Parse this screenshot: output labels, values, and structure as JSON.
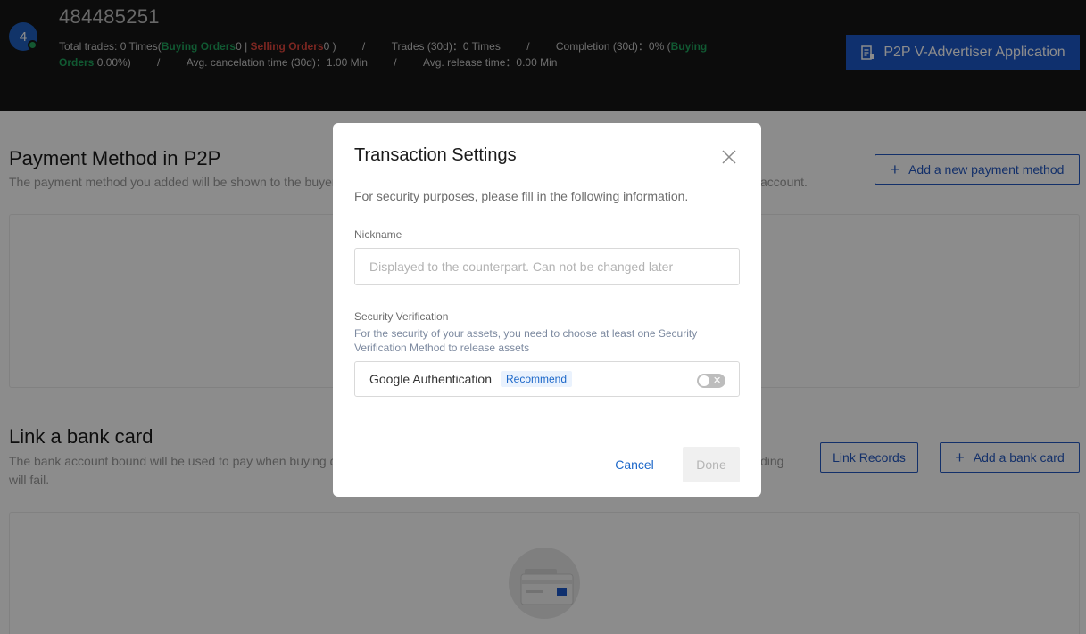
{
  "header": {
    "avatar_letter": "4",
    "user_id": "484485251",
    "stats": {
      "total_trades_prefix": "Total trades: 0 Times(",
      "buying_orders_label": "Buying Orders",
      "buying_orders_value": "0 | ",
      "selling_orders_label": "Selling Orders",
      "selling_orders_value": "0 )",
      "sep": "/",
      "trades_30d": "Trades (30d)：0 Times",
      "completion_30d": "Completion (30d)：0% (",
      "completion_buying_label": "Buying Orders",
      "completion_buying_value": " 0.00%)",
      "avg_cancel": "Avg. cancelation time (30d)：1.00 Min",
      "avg_release": "Avg. release time：0.00 Min"
    },
    "advertiser_button": "P2P V-Advertiser Application"
  },
  "payment_section": {
    "title": "Payment Method in P2P",
    "description_left": "The payment method you added will be shown to the buyer",
    "description_right": "account.",
    "add_button": "Add a new payment method"
  },
  "bank_section": {
    "title": "Link a bank card",
    "description_left": "The bank account bound will be used to pay when buying d",
    "description_right": "ding",
    "description_line2": "will fail.",
    "link_records_button": "Link Records",
    "add_button": "Add a bank card"
  },
  "modal": {
    "title": "Transaction Settings",
    "subtitle": "For security purposes, please fill in the following information.",
    "nickname_label": "Nickname",
    "nickname_placeholder": "Displayed to the counterpart. Can not be changed later",
    "nickname_value": "",
    "security_label": "Security Verification",
    "security_hint": "For the security of your assets, you need to choose at least one Security Verification Method to release assets",
    "google_auth_label": "Google Authentication",
    "recommend_badge": "Recommend",
    "google_auth_enabled": false,
    "cancel_button": "Cancel",
    "done_button": "Done"
  },
  "colors": {
    "accent": "#1d58c9",
    "buying": "#1fa35c",
    "selling": "#e0453c",
    "header_bg": "#171717"
  }
}
